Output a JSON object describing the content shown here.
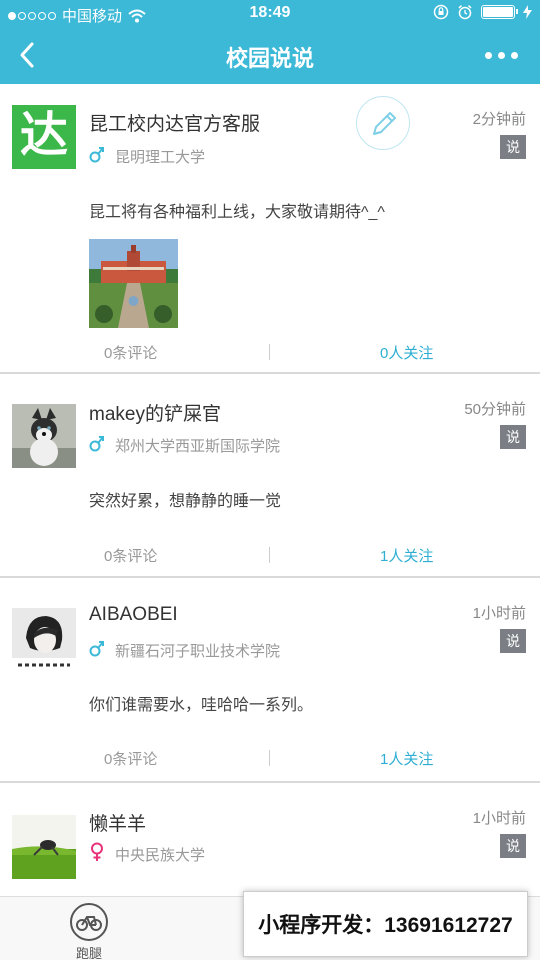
{
  "status": {
    "carrier": "中国移动",
    "time": "18:49"
  },
  "nav": {
    "title": "校园说说"
  },
  "posts": [
    {
      "name": "昆工校内达官方客服",
      "time": "2分钟前",
      "tag": "说",
      "gender": "male",
      "school": "昆明理工大学",
      "content": "昆工将有各种福利上线，大家敬请期待^_^",
      "avatar_text": "达",
      "comments": "0条评论",
      "follows": "0人关注"
    },
    {
      "name": "makey的铲屎官",
      "time": "50分钟前",
      "tag": "说",
      "gender": "male",
      "school": "郑州大学西亚斯国际学院",
      "content": "突然好累，想静静的睡一觉",
      "comments": "0条评论",
      "follows": "1人关注"
    },
    {
      "name": "AIBAOBEI",
      "time": "1小时前",
      "tag": "说",
      "gender": "male",
      "school": "新疆石河子职业技术学院",
      "content": "你们谁需要水，哇哈哈一系列。",
      "comments": "0条评论",
      "follows": "1人关注"
    },
    {
      "name": "懒羊羊",
      "time": "1小时前",
      "tag": "说",
      "gender": "female",
      "school": "中央民族大学"
    }
  ],
  "tabbar": {
    "tab1_label": "跑腿"
  },
  "banner": {
    "text": "小程序开发：13691612727"
  },
  "colors": {
    "primary": "#3db9d8",
    "follow": "#2eaed3",
    "female": "#e6337a"
  }
}
